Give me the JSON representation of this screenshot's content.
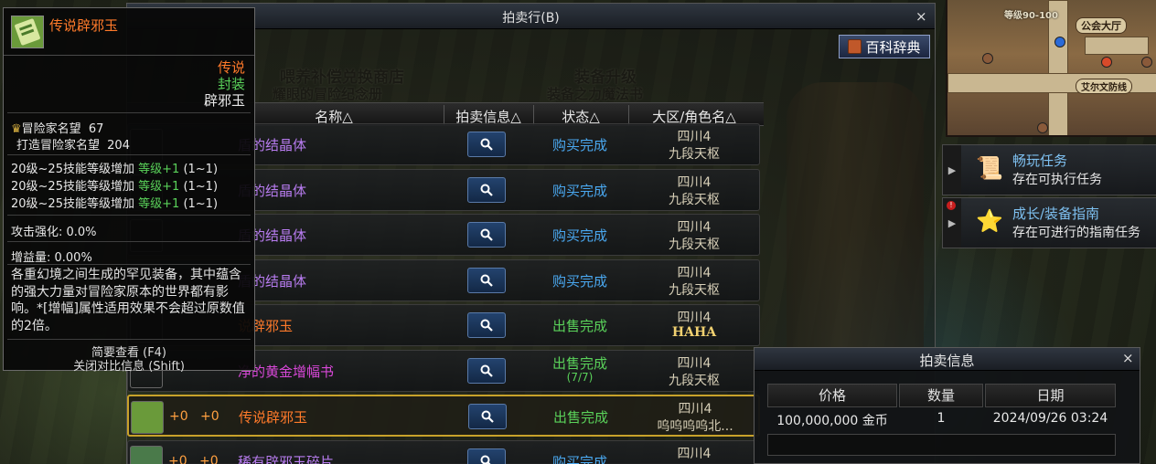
{
  "background": {
    "overlay_texts": [
      "喂养补偿兑换商店",
      "耀眼的冒险纪念册",
      "装备升级",
      "装备之力魔法书"
    ]
  },
  "minimap": {
    "level": "等级90-100",
    "guild_label": "公会大厅",
    "location_label": "艾尔文防线"
  },
  "quests": [
    {
      "title": "畅玩任务",
      "subtitle": "存在可执行任务",
      "icon": "scroll-icon"
    },
    {
      "title": "成长/装备指南",
      "subtitle": "存在可进行的指南任务",
      "icon": "star-book-icon",
      "alert": "!"
    }
  ],
  "auction": {
    "title": "拍卖行(B)",
    "close": "×",
    "encyclopedia_label": "百科辞典",
    "columns": {
      "name": "名称△",
      "info": "拍卖信息△",
      "status": "状态△",
      "server": "大区/角色名△"
    },
    "rows": [
      {
        "plus1": "",
        "plus2": "",
        "name": "盾的结晶体",
        "name_color": "#b87cf0",
        "status": "购买完成",
        "status_color": "#4aa8f0",
        "status_sub": "",
        "server": "四川4",
        "seller": "九段天枢",
        "selected": false
      },
      {
        "plus1": "",
        "plus2": "",
        "name": "盾的结晶体",
        "name_color": "#b87cf0",
        "status": "购买完成",
        "status_color": "#4aa8f0",
        "status_sub": "",
        "server": "四川4",
        "seller": "九段天枢",
        "selected": false
      },
      {
        "plus1": "",
        "plus2": "",
        "name": "盾的结晶体",
        "name_color": "#b87cf0",
        "status": "购买完成",
        "status_color": "#4aa8f0",
        "status_sub": "",
        "server": "四川4",
        "seller": "九段天枢",
        "selected": false
      },
      {
        "plus1": "",
        "plus2": "",
        "name": "盾的结晶体",
        "name_color": "#b87cf0",
        "status": "购买完成",
        "status_color": "#4aa8f0",
        "status_sub": "",
        "server": "四川4",
        "seller": "九段天枢",
        "selected": false
      },
      {
        "plus1": "",
        "plus2": "",
        "name": "说辟邪玉",
        "name_color": "#ff7a2a",
        "status": "出售完成",
        "status_color": "#5ad25a",
        "status_sub": "",
        "server": "四川4",
        "seller": "HAHA",
        "selected": false
      },
      {
        "plus1": "",
        "plus2": "",
        "name": "净的黄金增幅书",
        "name_color": "#d848d8",
        "status": "出售完成",
        "status_color": "#5ad25a",
        "status_sub": "(7/7)",
        "server": "四川4",
        "seller": "九段天枢",
        "selected": false
      },
      {
        "plus1": "+0",
        "plus2": "+0",
        "name": "传说辟邪玉",
        "name_color": "#ff7a2a",
        "status": "出售完成",
        "status_color": "#5ad25a",
        "status_sub": "",
        "server": "四川4",
        "seller": "呜呜呜呜北...",
        "selected": true
      },
      {
        "plus1": "+0",
        "plus2": "+0",
        "name": "稀有辟邪玉碎片",
        "name_color": "#b87cf0",
        "status": "购买完成",
        "status_color": "#4aa8f0",
        "status_sub": "",
        "server": "四川4",
        "seller": "",
        "selected": false
      }
    ]
  },
  "tooltip": {
    "name": "传说辟邪玉",
    "rarity": "传说",
    "type": "封装",
    "category": "辟邪玉",
    "fame_label": "冒险家名望",
    "fame_value": "67",
    "forge_fame_label": "打造冒险家名望",
    "forge_fame_value": "204",
    "skill_lines": [
      {
        "prefix": "20级~25技能等级增加",
        "bonus": "等级+1",
        "range": "(1~1)"
      },
      {
        "prefix": "20级~25技能等级增加",
        "bonus": "等级+1",
        "range": "(1~1)"
      },
      {
        "prefix": "20级~25技能等级增加",
        "bonus": "等级+1",
        "range": "(1~1)"
      }
    ],
    "attack_boost": "攻击强化: 0.0%",
    "buff_amount": "增益量: 0.00%",
    "description": "各重幻境之间生成的罕见装备，其中蕴含的强大力量对冒险家原本的世界都有影响。*[增幅]属性适用效果不会超过原数值的2倍。",
    "footer_1": "简要查看 (F4)",
    "footer_2": "关闭对比信息 (Shift)"
  },
  "info_panel": {
    "title": "拍卖信息",
    "close": "×",
    "columns": [
      "价格",
      "数量",
      "日期"
    ],
    "price": "100,000,000 金币",
    "quantity": "1",
    "date": "2024/09/26 03:24"
  },
  "colors": {
    "legendary": "#ff7a2a",
    "rare": "#b87cf0",
    "sold": "#5ad25a",
    "bought": "#4aa8f0",
    "selected_border": "#c8a22a"
  }
}
